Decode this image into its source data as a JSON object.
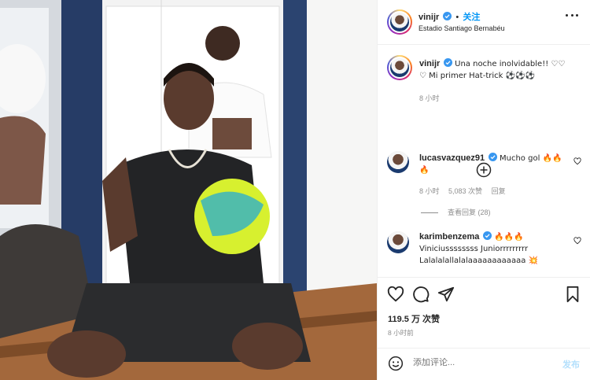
{
  "post": {
    "username": "vinijr",
    "follow_label": "关注",
    "separator": "•",
    "location": "Estadio Santiago Bernabéu"
  },
  "caption": {
    "username": "vinijr",
    "text": "Una noche inolvidable!! ♡♡\n♡ Mi primer Hat-trick ⚽⚽⚽",
    "time": "8 小时"
  },
  "comments": [
    {
      "username": "lucasvazquez91",
      "text": "Mucho gol 🔥🔥\n🔥",
      "time": "8 小时",
      "likes": "5,083 次赞",
      "reply_label": "回复",
      "view_replies": "查看回复 (28)"
    },
    {
      "username": "karimbenzema",
      "text": "🔥🔥🔥\nViniciussssssss Juniorrrrrrrrr\nLalalalallalalaaaaaaaaaaaa 💥"
    }
  ],
  "stats": {
    "likes": "119.5 万 次赞",
    "time": "8 小时前"
  },
  "composer": {
    "placeholder": "添加评论...",
    "post_label": "发布"
  },
  "icons": {
    "verified": "verified-badge-icon",
    "more": "more-options-icon",
    "load_more": "plus-circle-icon",
    "like": "heart-icon",
    "comment": "comment-bubble-icon",
    "share": "paper-plane-icon",
    "save": "bookmark-icon",
    "emoji": "emoji-smiley-icon"
  },
  "colors": {
    "accent": "#0095f6",
    "post_disabled": "#b2dffc",
    "verified": "#3897f0",
    "fire": "#f56a00"
  }
}
